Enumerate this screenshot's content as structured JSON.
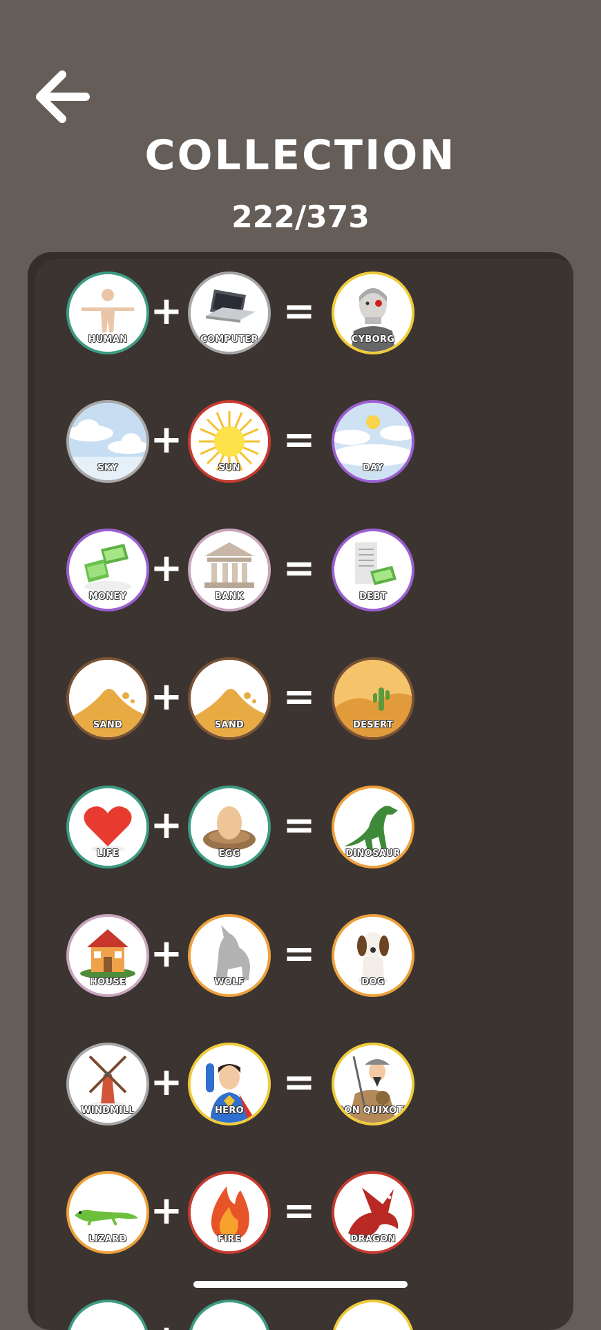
{
  "header": {
    "title": "COLLECTION",
    "count": "222/373"
  },
  "colors": {
    "background": "#655d58",
    "panel": "#3c3430",
    "rarity_green": "#3d9b83",
    "rarity_gray": "#a7a7a7",
    "rarity_yellow": "#f0cc3a",
    "rarity_red": "#c63a2f",
    "rarity_purple": "#9a5fd0",
    "rarity_brown": "#7a5234",
    "rarity_orange": "#eda13c",
    "rarity_pink": "#c9a6bd"
  },
  "recipes": [
    {
      "a": {
        "label": "HUMAN",
        "icon": "human-icon",
        "ring": "#3d9b83"
      },
      "b": {
        "label": "COMPUTER",
        "icon": "laptop-icon",
        "ring": "#a7a7a7"
      },
      "result": {
        "label": "CYBORG",
        "icon": "cyborg-icon",
        "ring": "#f0cc3a"
      }
    },
    {
      "a": {
        "label": "SKY",
        "icon": "clouds-icon",
        "ring": "#a7a7a7"
      },
      "b": {
        "label": "SUN",
        "icon": "sun-icon",
        "ring": "#c63a2f"
      },
      "result": {
        "label": "DAY",
        "icon": "day-icon",
        "ring": "#9a5fd0"
      }
    },
    {
      "a": {
        "label": "MONEY",
        "icon": "money-icon",
        "ring": "#9a5fd0"
      },
      "b": {
        "label": "BANK",
        "icon": "bank-icon",
        "ring": "#c9a6bd"
      },
      "result": {
        "label": "DEBT",
        "icon": "debt-icon",
        "ring": "#9a5fd0"
      }
    },
    {
      "a": {
        "label": "SAND",
        "icon": "sand-icon",
        "ring": "#7a5234"
      },
      "b": {
        "label": "SAND",
        "icon": "sand-icon",
        "ring": "#7a5234"
      },
      "result": {
        "label": "DESERT",
        "icon": "desert-icon",
        "ring": "#7a5234"
      }
    },
    {
      "a": {
        "label": "LIFE",
        "icon": "heart-icon",
        "ring": "#3d9b83"
      },
      "b": {
        "label": "EGG",
        "icon": "egg-icon",
        "ring": "#3d9b83"
      },
      "result": {
        "label": "DINOSAUR",
        "icon": "dinosaur-icon",
        "ring": "#eda13c"
      }
    },
    {
      "a": {
        "label": "HOUSE",
        "icon": "house-icon",
        "ring": "#c9a6bd"
      },
      "b": {
        "label": "WOLF",
        "icon": "wolf-icon",
        "ring": "#eda13c"
      },
      "result": {
        "label": "DOG",
        "icon": "dog-icon",
        "ring": "#eda13c"
      }
    },
    {
      "a": {
        "label": "WINDMILL",
        "icon": "windmill-icon",
        "ring": "#a7a7a7"
      },
      "b": {
        "label": "HERO",
        "icon": "hero-icon",
        "ring": "#f0cc3a"
      },
      "result": {
        "label": "DON QUIXOTE",
        "icon": "knight-icon",
        "ring": "#f0cc3a"
      }
    },
    {
      "a": {
        "label": "LIZARD",
        "icon": "lizard-icon",
        "ring": "#eda13c"
      },
      "b": {
        "label": "FIRE",
        "icon": "fire-icon",
        "ring": "#c63a2f"
      },
      "result": {
        "label": "DRAGON",
        "icon": "dragon-icon",
        "ring": "#c63a2f"
      }
    },
    {
      "a": {
        "label": "",
        "icon": "partial-icon",
        "ring": "#3d9b83"
      },
      "b": {
        "label": "",
        "icon": "partial-icon",
        "ring": "#3d9b83"
      },
      "result": {
        "label": "",
        "icon": "partial-icon",
        "ring": "#f0cc3a"
      }
    }
  ],
  "operators": {
    "plus": "+",
    "equals": "="
  }
}
